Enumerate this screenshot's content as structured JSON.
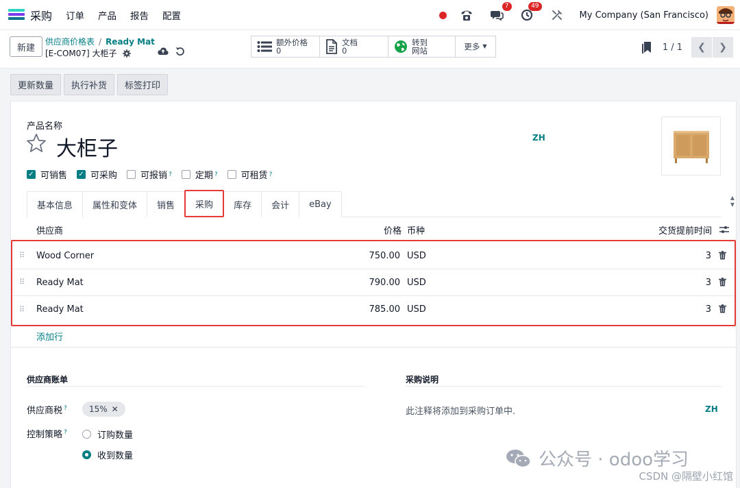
{
  "nav": {
    "app_name": "采购",
    "menu": [
      "订单",
      "产品",
      "报告",
      "配置"
    ],
    "messages_badge": "7",
    "activities_badge": "49",
    "company": "My Company (San Francisco)"
  },
  "control": {
    "new_label": "新建",
    "breadcrumb_parent": "供应商价格表",
    "breadcrumb_current": "Ready Mat",
    "record_title": "[E-COM07] 大柜子",
    "smart_buttons": [
      {
        "label": "额外价格",
        "value": "0"
      },
      {
        "label": "文档",
        "value": "0"
      },
      {
        "label": "转到",
        "value": "网站"
      }
    ],
    "more_label": "更多",
    "pager": "1 / 1"
  },
  "status_buttons": [
    "更新数量",
    "执行补货",
    "标签打印"
  ],
  "form": {
    "product_name_label": "产品名称",
    "product_name": "大柜子",
    "lang": "ZH",
    "checkboxes": [
      {
        "label": "可销售",
        "checked": true,
        "help": false
      },
      {
        "label": "可采购",
        "checked": true,
        "help": false
      },
      {
        "label": "可报销",
        "checked": false,
        "help": true
      },
      {
        "label": "定期",
        "checked": false,
        "help": true
      },
      {
        "label": "可租赁",
        "checked": false,
        "help": true
      }
    ],
    "tabs": [
      "基本信息",
      "属性和变体",
      "销售",
      "采购",
      "库存",
      "会计",
      "eBay"
    ],
    "active_tab": "采购"
  },
  "vendor_table": {
    "headers": {
      "vendor": "供应商",
      "price": "价格",
      "currency": "币种",
      "lead_time": "交货提前时间"
    },
    "rows": [
      {
        "vendor": "Wood Corner",
        "price": "750.00",
        "currency": "USD",
        "lead_time": "3"
      },
      {
        "vendor": "Ready Mat",
        "price": "790.00",
        "currency": "USD",
        "lead_time": "3"
      },
      {
        "vendor": "Ready Mat",
        "price": "785.00",
        "currency": "USD",
        "lead_time": "3"
      }
    ],
    "add_line": "添加行"
  },
  "vendor_bills": {
    "title": "供应商账单",
    "tax_label": "供应商税",
    "tax_value": "15%",
    "control_label": "控制策略",
    "options": [
      "订购数量",
      "收到数量"
    ],
    "selected": "收到数量"
  },
  "purchase_desc": {
    "title": "采购说明",
    "placeholder": "此注释将添加到采购订单中.",
    "lang": "ZH"
  },
  "watermark": {
    "text": "公众号 · odoo学习",
    "sub": "CSDN @隔壁小红馆"
  },
  "colors": {
    "accent": "#017e84",
    "highlight": "#e53935",
    "badge": "#dc2626"
  }
}
